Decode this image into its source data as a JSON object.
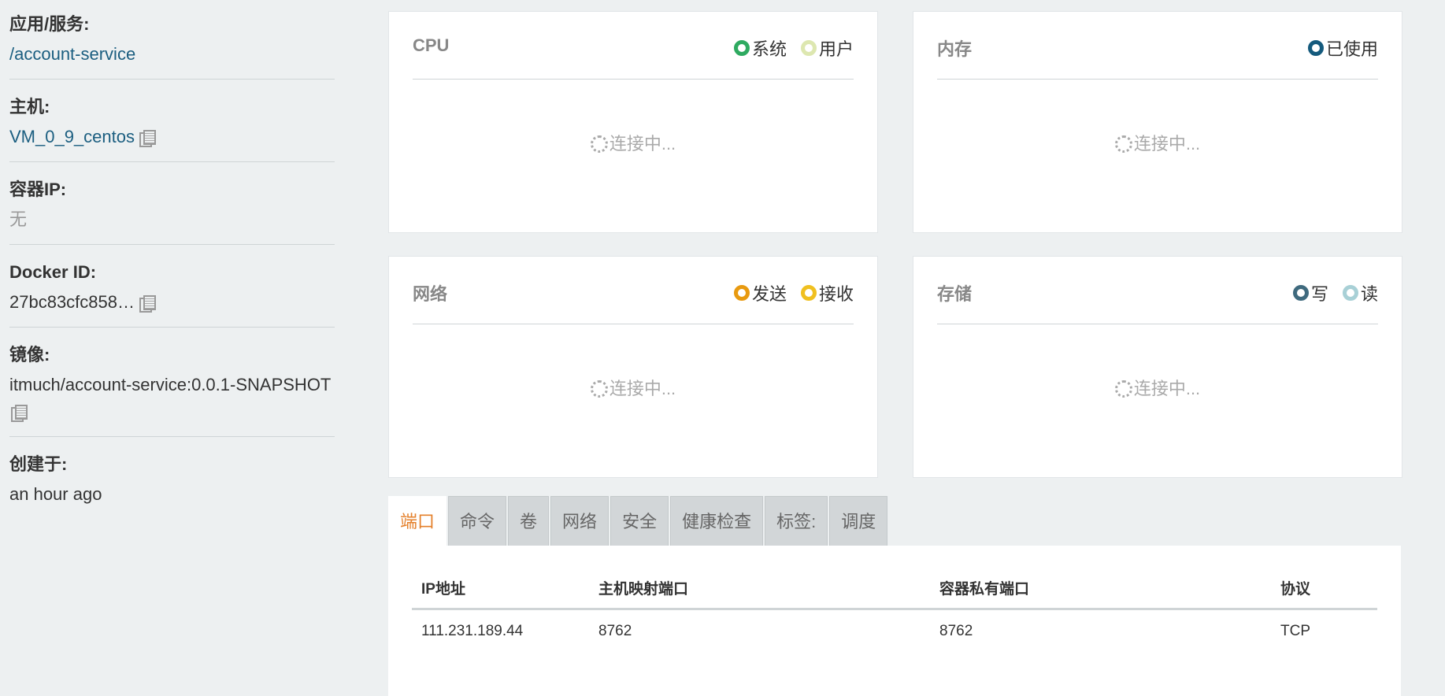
{
  "sidebar": {
    "app_service": {
      "label": "应用/服务:",
      "value": "/account-service"
    },
    "host": {
      "label": "主机:",
      "value": "VM_0_9_centos"
    },
    "container_ip": {
      "label": "容器IP:",
      "value": "无"
    },
    "docker_id": {
      "label": "Docker ID:",
      "value": "27bc83cfc858…"
    },
    "image": {
      "label": "镜像:",
      "value": "itmuch/account-service:0.0.1-SNAPSHOT"
    },
    "created": {
      "label": "创建于:",
      "value": "an hour ago"
    }
  },
  "cards": {
    "cpu": {
      "title": "CPU",
      "legend": [
        {
          "label": "系统",
          "color": "#2eaa60"
        },
        {
          "label": "用户",
          "color": "#dde7b0"
        }
      ],
      "status": "连接中..."
    },
    "memory": {
      "title": "内存",
      "legend": [
        {
          "label": "已使用",
          "color": "#145a7d"
        }
      ],
      "status": "连接中..."
    },
    "network": {
      "title": "网络",
      "legend": [
        {
          "label": "发送",
          "color": "#e89a10"
        },
        {
          "label": "接收",
          "color": "#f0c020"
        }
      ],
      "status": "连接中..."
    },
    "storage": {
      "title": "存储",
      "legend": [
        {
          "label": "写",
          "color": "#3f6a7e"
        },
        {
          "label": "读",
          "color": "#a8d0d6"
        }
      ],
      "status": "连接中..."
    }
  },
  "tabs": [
    "端口",
    "命令",
    "卷",
    "网络",
    "安全",
    "健康检查",
    "标签:",
    "调度"
  ],
  "ports_table": {
    "headers": [
      "IP地址",
      "主机映射端口",
      "容器私有端口",
      "协议"
    ],
    "rows": [
      [
        "111.231.189.44",
        "8762",
        "8762",
        "TCP"
      ]
    ]
  }
}
